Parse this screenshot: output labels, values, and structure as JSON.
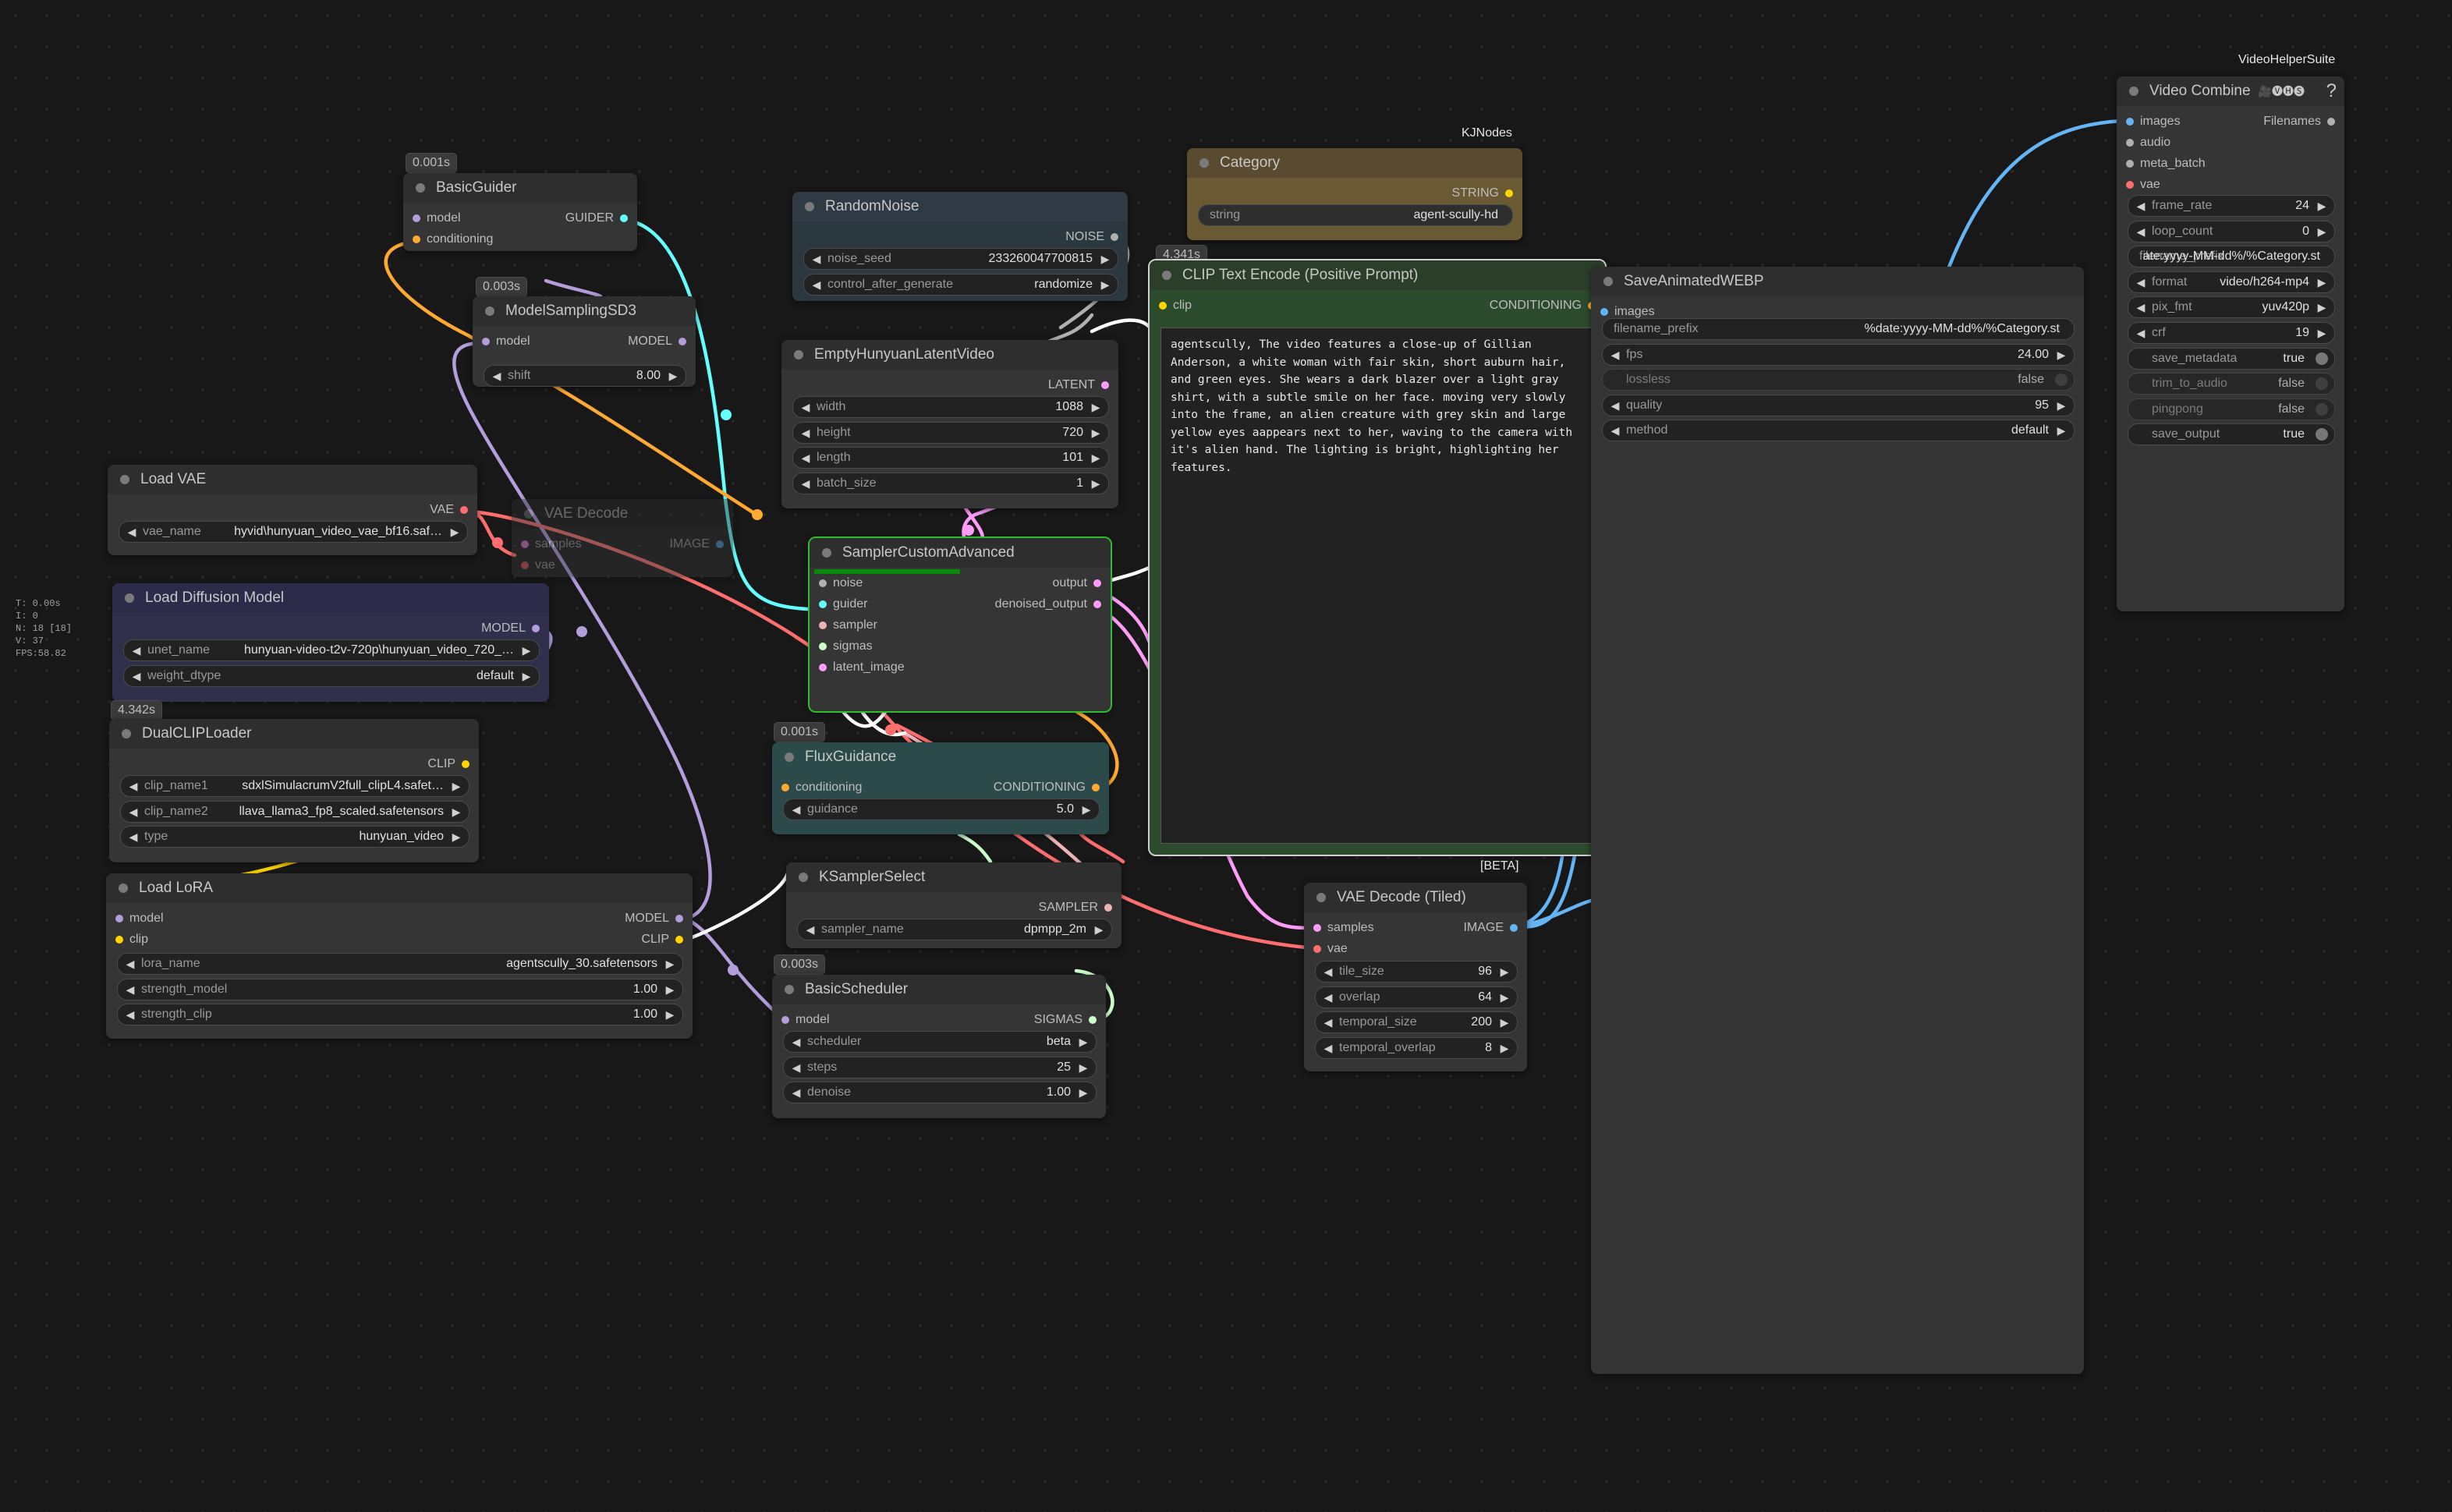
{
  "stats": {
    "lines": [
      "T: 0.00s",
      "I: 0",
      "N: 18 [18]",
      "V: 37",
      "FPS:58.82"
    ]
  },
  "group_tags": {
    "video_helper_suite": "VideoHelperSuite",
    "kjnodes": "KJNodes",
    "beta": "[BETA]"
  },
  "colors": {
    "canvas": "#181818",
    "node_body": "#353535",
    "node_title": "#2e2e2e",
    "model": "#b39ddb",
    "clip": "#ffd500",
    "vae": "#ff6e6e",
    "conditioning": "#ffa931",
    "latent": "#ff9cf9",
    "image": "#64b5f6",
    "noise": "#b0b0b0",
    "guider": "#66ffff",
    "sigmas": "#cdffcd",
    "sampler": "#ecb4b4",
    "running_border": "#2bbd2b",
    "progress": "#0a8a0a"
  },
  "nodes": {
    "basic_guider": {
      "badge": "0.001s",
      "title": "BasicGuider",
      "inputs": [
        "model",
        "conditioning"
      ],
      "output": "GUIDER"
    },
    "model_sampling": {
      "badge": "0.003s",
      "title": "ModelSamplingSD3",
      "input": "model",
      "output": "MODEL",
      "widgets": [
        {
          "label": "shift",
          "value": "8.00"
        }
      ]
    },
    "random_noise": {
      "title": "RandomNoise",
      "output": "NOISE",
      "widgets": [
        {
          "label": "noise_seed",
          "value": "233260047700815"
        },
        {
          "label": "control_after_generate",
          "value": "randomize"
        }
      ]
    },
    "category": {
      "title": "Category",
      "output": "STRING",
      "widgets": [
        {
          "label": "string",
          "value": "agent-scully-hd"
        }
      ]
    },
    "empty_latent": {
      "title": "EmptyHunyuanLatentVideo",
      "output": "LATENT",
      "widgets": [
        {
          "label": "width",
          "value": "1088"
        },
        {
          "label": "height",
          "value": "720"
        },
        {
          "label": "length",
          "value": "101"
        },
        {
          "label": "batch_size",
          "value": "1"
        }
      ]
    },
    "clip_text_encode": {
      "badge": "4.341s",
      "title": "CLIP Text Encode (Positive Prompt)",
      "input": "clip",
      "output": "CONDITIONING",
      "text": "agentscully, The video features a close-up of Gillian Anderson, a white woman with fair skin, short auburn hair, and green eyes. She wears a dark blazer over a light gray shirt, with a subtle smile on her face. moving very slowly into the frame, an alien creature with grey skin and large yellow eyes aappears next to her, waving to the camera with it's alien hand. The lighting is bright, highlighting her features."
    },
    "load_vae": {
      "title": "Load VAE",
      "output": "VAE",
      "widgets": [
        {
          "label": "vae_name",
          "value": "hyvid\\hunyuan_video_vae_bf16.saf…"
        }
      ]
    },
    "vae_decode": {
      "title": "VAE Decode",
      "inputs": [
        "samples",
        "vae"
      ],
      "output": "IMAGE"
    },
    "sampler_custom": {
      "title": "SamplerCustomAdvanced",
      "inputs": [
        "noise",
        "guider",
        "sampler",
        "sigmas",
        "latent_image"
      ],
      "outputs": [
        "output",
        "denoised_output"
      ],
      "progress": 0.5
    },
    "load_diffusion": {
      "title": "Load Diffusion Model",
      "output": "MODEL",
      "widgets": [
        {
          "label": "unet_name",
          "value": "hunyuan-video-t2v-720p\\hunyuan_video_720_…"
        },
        {
          "label": "weight_dtype",
          "value": "default"
        }
      ]
    },
    "dual_clip": {
      "badge": "4.342s",
      "title": "DualCLIPLoader",
      "output": "CLIP",
      "widgets": [
        {
          "label": "clip_name1",
          "value": "sdxlSimulacrumV2full_clipL4.safet…"
        },
        {
          "label": "clip_name2",
          "value": "llava_llama3_fp8_scaled.safetensors"
        },
        {
          "label": "type",
          "value": "hunyuan_video"
        }
      ]
    },
    "flux_guidance": {
      "badge": "0.001s",
      "title": "FluxGuidance",
      "input": "conditioning",
      "output": "CONDITIONING",
      "widgets": [
        {
          "label": "guidance",
          "value": "5.0"
        }
      ]
    },
    "load_lora": {
      "title": "Load LoRA",
      "inputs": [
        "model",
        "clip"
      ],
      "outputs": [
        "MODEL",
        "CLIP"
      ],
      "widgets": [
        {
          "label": "lora_name",
          "value": "agentscully_30.safetensors"
        },
        {
          "label": "strength_model",
          "value": "1.00"
        },
        {
          "label": "strength_clip",
          "value": "1.00"
        }
      ]
    },
    "ksampler_select": {
      "title": "KSamplerSelect",
      "output": "SAMPLER",
      "widgets": [
        {
          "label": "sampler_name",
          "value": "dpmpp_2m"
        }
      ]
    },
    "basic_scheduler": {
      "badge": "0.003s",
      "title": "BasicScheduler",
      "input": "model",
      "output": "SIGMAS",
      "widgets": [
        {
          "label": "scheduler",
          "value": "beta"
        },
        {
          "label": "steps",
          "value": "25"
        },
        {
          "label": "denoise",
          "value": "1.00"
        }
      ]
    },
    "vae_decode_tiled": {
      "title": "VAE Decode (Tiled)",
      "inputs": [
        "samples",
        "vae"
      ],
      "output": "IMAGE",
      "widgets": [
        {
          "label": "tile_size",
          "value": "96"
        },
        {
          "label": "overlap",
          "value": "64"
        },
        {
          "label": "temporal_size",
          "value": "200"
        },
        {
          "label": "temporal_overlap",
          "value": "8"
        }
      ]
    },
    "save_webp": {
      "title": "SaveAnimatedWEBP",
      "input": "images",
      "widgets": [
        {
          "label": "filename_prefix",
          "value": "%date:yyyy-MM-dd%/%Category.st"
        },
        {
          "label": "fps",
          "value": "24.00"
        },
        {
          "label": "lossless",
          "value": "false"
        },
        {
          "label": "quality",
          "value": "95"
        },
        {
          "label": "method",
          "value": "default"
        }
      ]
    },
    "video_combine": {
      "title": "Video Combine",
      "title_icons": "🎥🅥🅗🅢",
      "help": "?",
      "inputs": [
        "images",
        "audio",
        "meta_batch",
        "vae"
      ],
      "output": "Filenames",
      "widgets": [
        {
          "label": "frame_rate",
          "value": "24"
        },
        {
          "label": "loop_count",
          "value": "0"
        },
        {
          "label": "filename_prefix",
          "value": "ate:yyyy-MM-dd%/%Category.st"
        },
        {
          "label": "format",
          "value": "video/h264-mp4"
        },
        {
          "label": "pix_fmt",
          "value": "yuv420p"
        },
        {
          "label": "crf",
          "value": "19"
        },
        {
          "label": "save_metadata",
          "value": "true"
        },
        {
          "label": "trim_to_audio",
          "value": "false"
        },
        {
          "label": "pingpong",
          "value": "false"
        },
        {
          "label": "save_output",
          "value": "true"
        }
      ]
    }
  }
}
